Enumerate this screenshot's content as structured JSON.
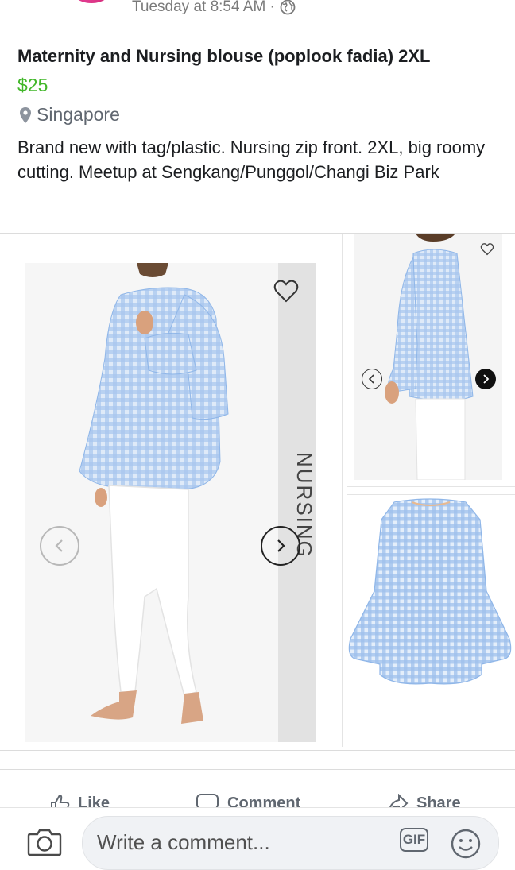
{
  "post": {
    "timestamp": "Tuesday at 8:54 AM ·",
    "title": "Maternity and Nursing blouse (poplook fadia) 2XL",
    "price": "$25",
    "location": "Singapore",
    "description": "Brand new with tag/plastic. Nursing zip front. 2XL, big roomy cutting. Meetup at Sengkang/Punggol/Changi Biz Park"
  },
  "gallery": {
    "main_overlay_text": "NURSING"
  },
  "actions": {
    "like": "Like",
    "comment": "Comment",
    "share": "Share"
  },
  "comment_bar": {
    "placeholder": "Write a comment...",
    "gif_label": "GIF"
  },
  "colors": {
    "price": "#42b72a",
    "gingham": "#8fb6e8",
    "text": "#1c1e21",
    "muted": "#606770"
  },
  "icons": [
    "globe-icon",
    "location-pin-icon",
    "heart-icon",
    "chevron-left-icon",
    "chevron-right-icon",
    "like-icon",
    "comment-icon",
    "share-icon",
    "camera-icon",
    "gif-icon",
    "emoji-icon"
  ]
}
